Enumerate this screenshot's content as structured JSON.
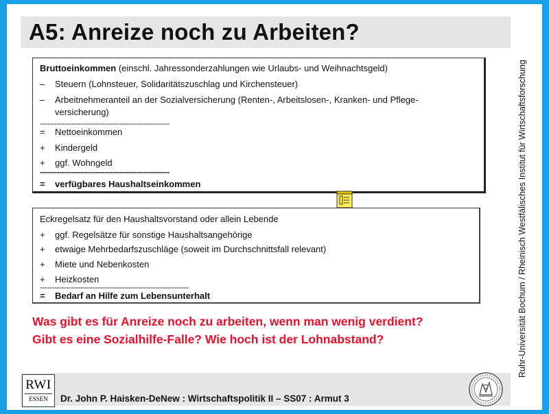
{
  "title": "A5: Anreize noch zu Arbeiten?",
  "box1": {
    "header_bold": "Bruttoeinkommen",
    "header_rest": " (einschl. Jahressonderzahlungen wie Urlaubs- und Weihnachtsgeld)",
    "items": [
      {
        "sym": "–",
        "text": "Steuern (Lohnsteuer, Solidaritätszuschlag und Kirchensteuer)"
      },
      {
        "sym": "–",
        "text": "Arbeitnehmeranteil an der Sozialversicherung (Renten-, Arbeitslosen-, Kranken- und Pflege-versicherung)"
      }
    ],
    "separator": "------------------------------------------------------",
    "items2": [
      {
        "sym": "=",
        "text": "Nettoeinkommen"
      },
      {
        "sym": "+",
        "text": "Kindergeld"
      },
      {
        "sym": "+",
        "text": "ggf. Wohngeld"
      }
    ],
    "result_sym": "=",
    "result": "verfügbares Haushaltseinkommen"
  },
  "box2": {
    "header": "Eckregelsatz für den Haushaltsvorstand oder allein Lebende",
    "items": [
      {
        "sym": "+",
        "text": "ggf. Regelsätze für sonstige Haushaltsangehörige"
      },
      {
        "sym": "+",
        "text": "etwaige Mehrbedarfszuschläge (soweit im Durchschnittsfall relevant)"
      },
      {
        "sym": "+",
        "text": "Miete und Nebenkosten"
      },
      {
        "sym": "+",
        "text": "Heizkosten"
      }
    ],
    "separator": "--------------------------------------------------------------",
    "result_sym": "=",
    "result": "Bedarf an Hilfe zum Lebensunterhalt"
  },
  "question_line1": "Was gibt es für Anreize noch zu arbeiten, wenn man wenig verdient?",
  "question_line2": "Gibt es eine Sozialhilfe-Falle? Wie hoch ist der Lohnabstand?",
  "logo": {
    "line1": "RWI",
    "line2": "ESSEN"
  },
  "footer": "Dr. John P. Haisken-DeNew : Wirtschaftspolitik II – SS07 : Armut 3",
  "side_text": "Ruhr-Universität Bochum     /     Rheinisch Westfälisches Institut für Wirtschaftsforschung",
  "colors": {
    "frame": "#1aa0e6",
    "question": "#e8102a",
    "bar": "#e6e6e6"
  }
}
